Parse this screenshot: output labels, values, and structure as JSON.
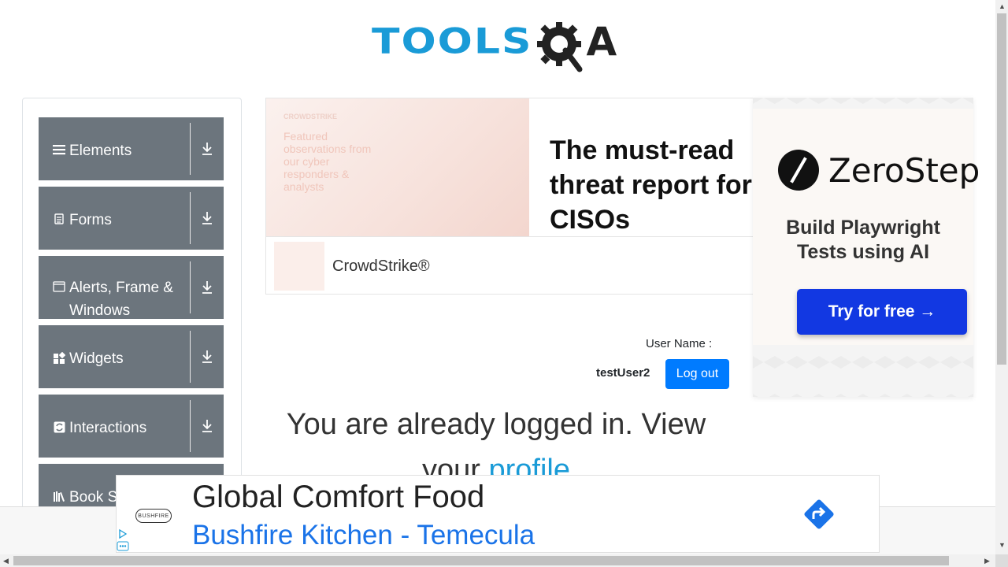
{
  "header": {
    "logo_text": "TOOLS",
    "logo_suffix": "A"
  },
  "sidebar": {
    "groups": [
      {
        "label": "Elements",
        "icon": "hamburger-icon"
      },
      {
        "label": "Forms",
        "icon": "document-icon"
      },
      {
        "label": "Alerts, Frame & Windows",
        "icon": "window-icon"
      },
      {
        "label": "Widgets",
        "icon": "widgets-icon"
      },
      {
        "label": "Interactions",
        "icon": "interactions-icon"
      },
      {
        "label": "Book Store Application",
        "icon": "books-icon"
      }
    ]
  },
  "ad_top": {
    "image_tag": "CROWDSTRIKE",
    "image_text": "Featured observations from our cyber responders & analysts",
    "headline": "The must-read threat report for CISOs",
    "brand": "CrowdStrike®"
  },
  "ad_overlay": {
    "brand": "ZeroStep",
    "tagline": "Build Playwright Tests using AI",
    "cta": "Try for free →"
  },
  "profile": {
    "user_label": "User Name :",
    "user_value": "testUser2",
    "logout_label": "Log out",
    "message_prefix": "You are already logged in. View your ",
    "message_link": "profile"
  },
  "ad_bottom": {
    "logo_text": "BUSHFIRE",
    "title": "Global Comfort Food",
    "subtitle": "Bushfire Kitchen - Temecula"
  },
  "colors": {
    "brand_blue": "#1a9bd7",
    "sidebar_gray": "#6c757d",
    "button_blue": "#007bff"
  }
}
